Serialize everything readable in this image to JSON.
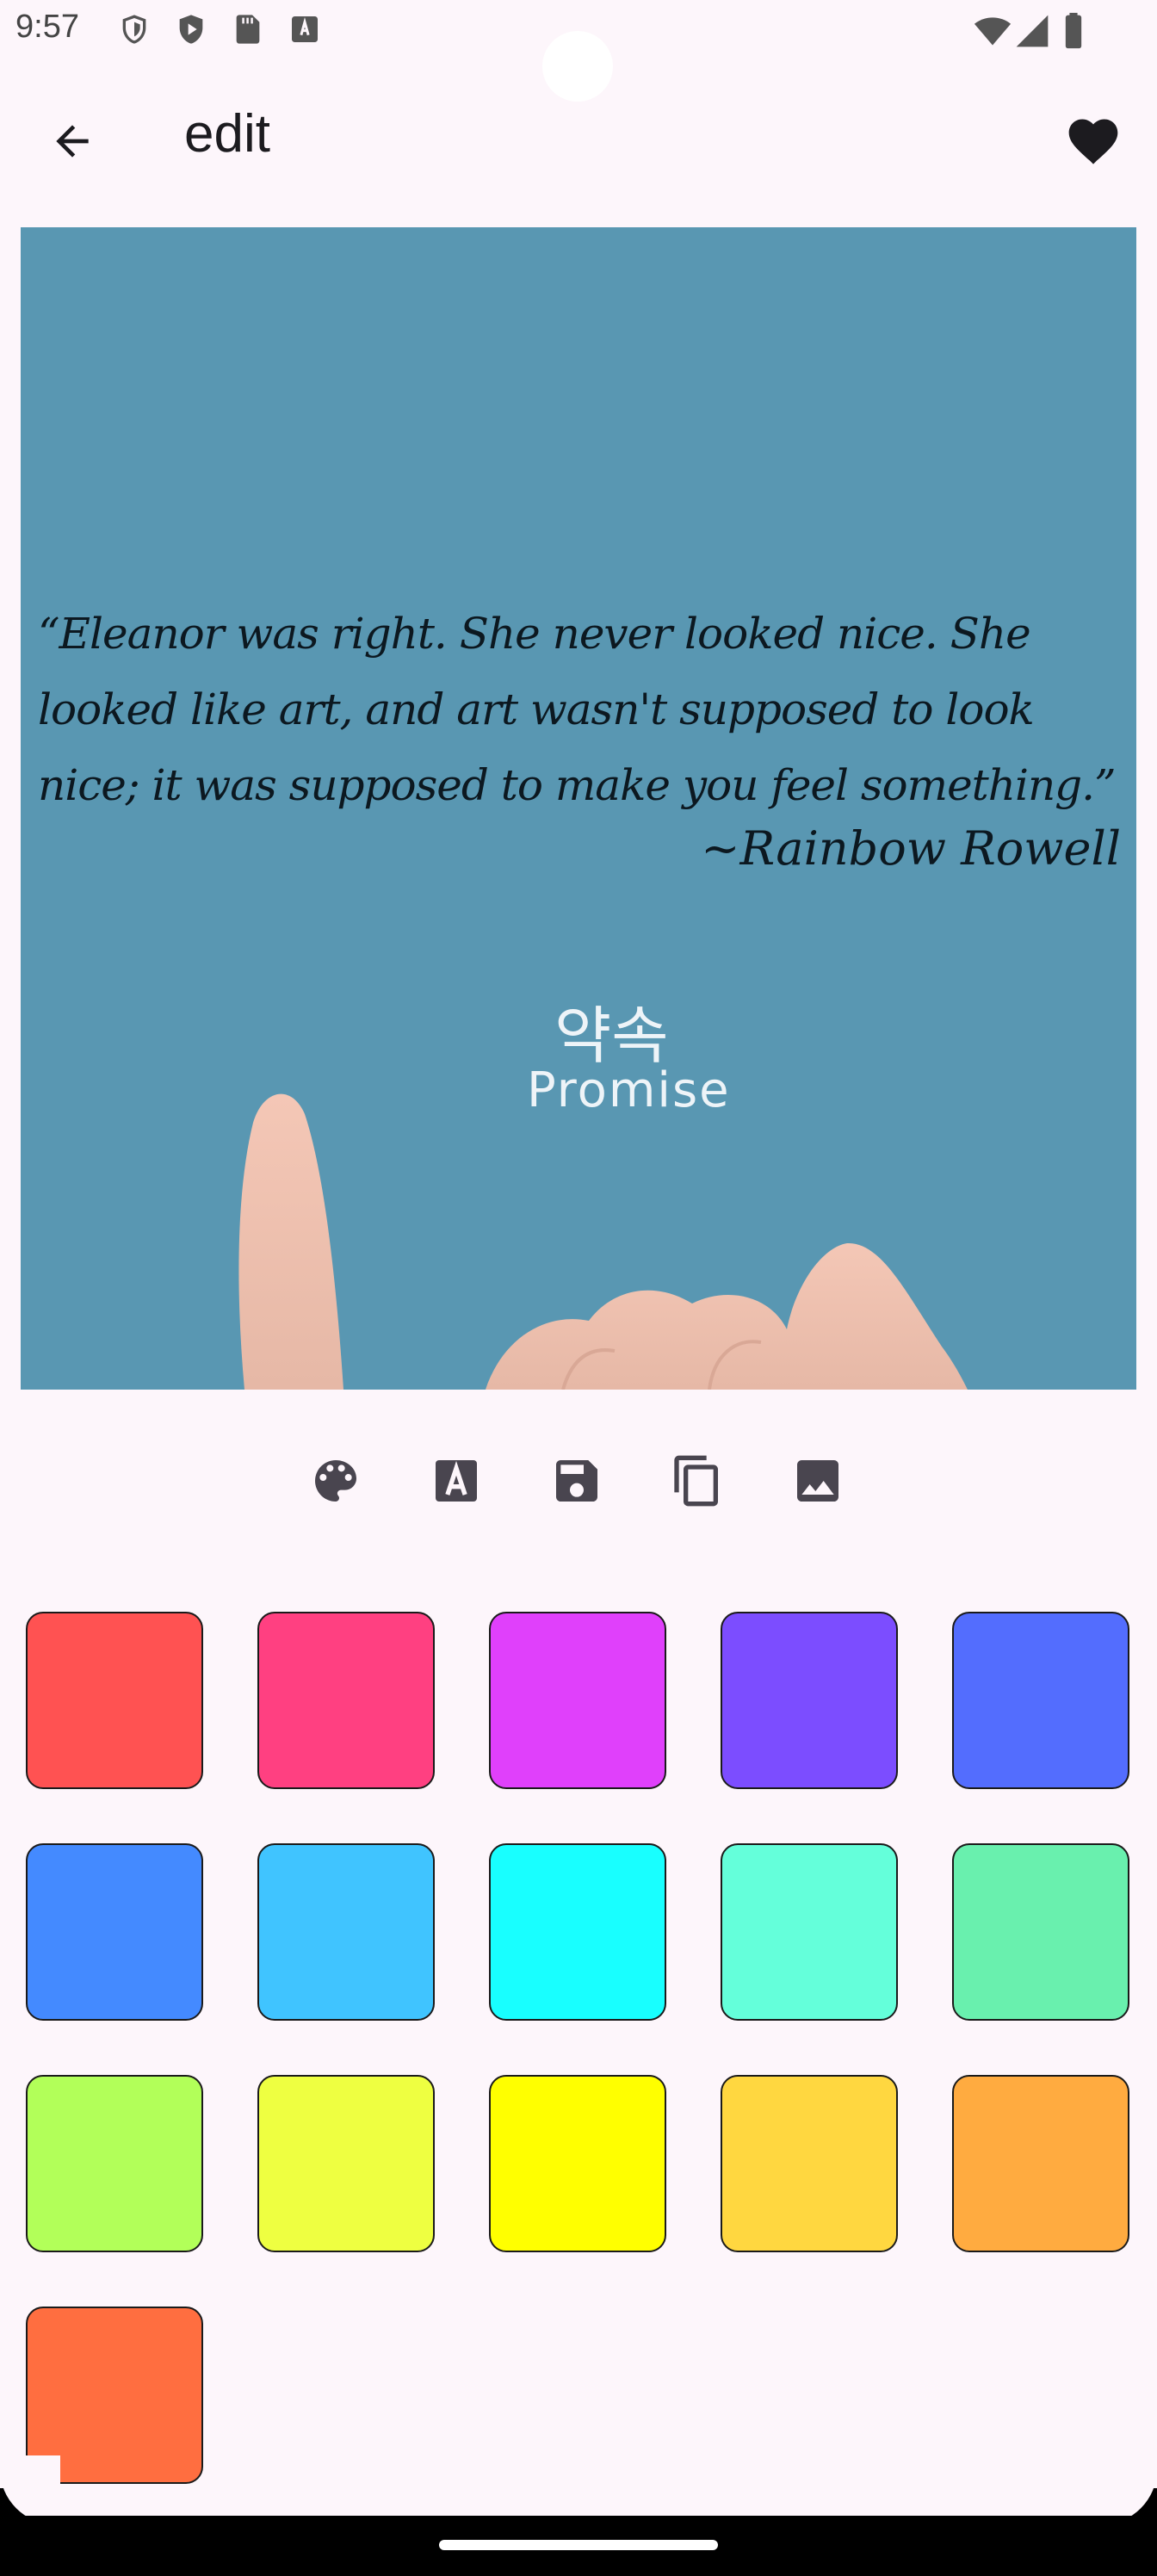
{
  "status_bar": {
    "time": "9:57",
    "left_icons": [
      "shield-icon",
      "play-protect-icon",
      "sd-card-icon",
      "font-icon"
    ],
    "right_icons": [
      "wifi-icon",
      "signal-icon",
      "battery-icon"
    ]
  },
  "app_bar": {
    "title": "edit",
    "back_icon": "arrow-back-icon",
    "favorite_icon": "heart-icon"
  },
  "quote_image": {
    "quote": "“Eleanor was right. She never looked nice. She looked like art, and art wasn't supposed to look nice; it was supposed to make you feel something.”",
    "author": "~Rainbow Rowell",
    "watermark_korean": "약속",
    "watermark_english": "Promise",
    "background_color": "#5997b2"
  },
  "toolbar": {
    "tools": [
      {
        "icon": "palette-icon"
      },
      {
        "icon": "text-format-icon"
      },
      {
        "icon": "save-icon"
      },
      {
        "icon": "copy-icon"
      },
      {
        "icon": "image-icon"
      }
    ]
  },
  "color_swatches": [
    "#ff5252",
    "#ff4081",
    "#e040fb",
    "#7c4dff",
    "#536dfe",
    "#448aff",
    "#40c4ff",
    "#18ffff",
    "#64ffda",
    "#69f0ae",
    "#b2ff59",
    "#eeff41",
    "#ffff00",
    "#ffd740",
    "#ffab40",
    "#ff6e40"
  ]
}
